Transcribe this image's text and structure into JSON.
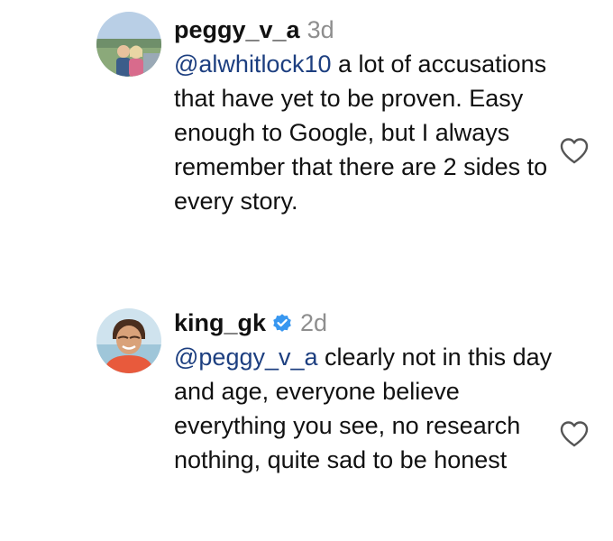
{
  "comments": [
    {
      "username": "peggy_v_a",
      "verified": false,
      "time": "3d",
      "mention": "@alwhitlock10",
      "text": " a lot of accusations that have yet to be proven. Easy enough to Google, but I always remember that there are 2 sides to every story.",
      "like_icon": "heart-outline-icon",
      "avatar": "avatar-photo"
    },
    {
      "username": "king_gk",
      "verified": true,
      "verified_icon": "verified-badge-icon",
      "time": "2d",
      "mention": "@peggy_v_a",
      "text": " clearly not in this day and age, everyone believe everything you see, no research nothing, quite sad to be honest",
      "like_icon": "heart-outline-icon",
      "avatar": "avatar-photo"
    }
  ],
  "colors": {
    "text": "#111111",
    "mention": "#1d3f80",
    "timestamp": "#8e8e8e",
    "verified": "#3897f0"
  }
}
